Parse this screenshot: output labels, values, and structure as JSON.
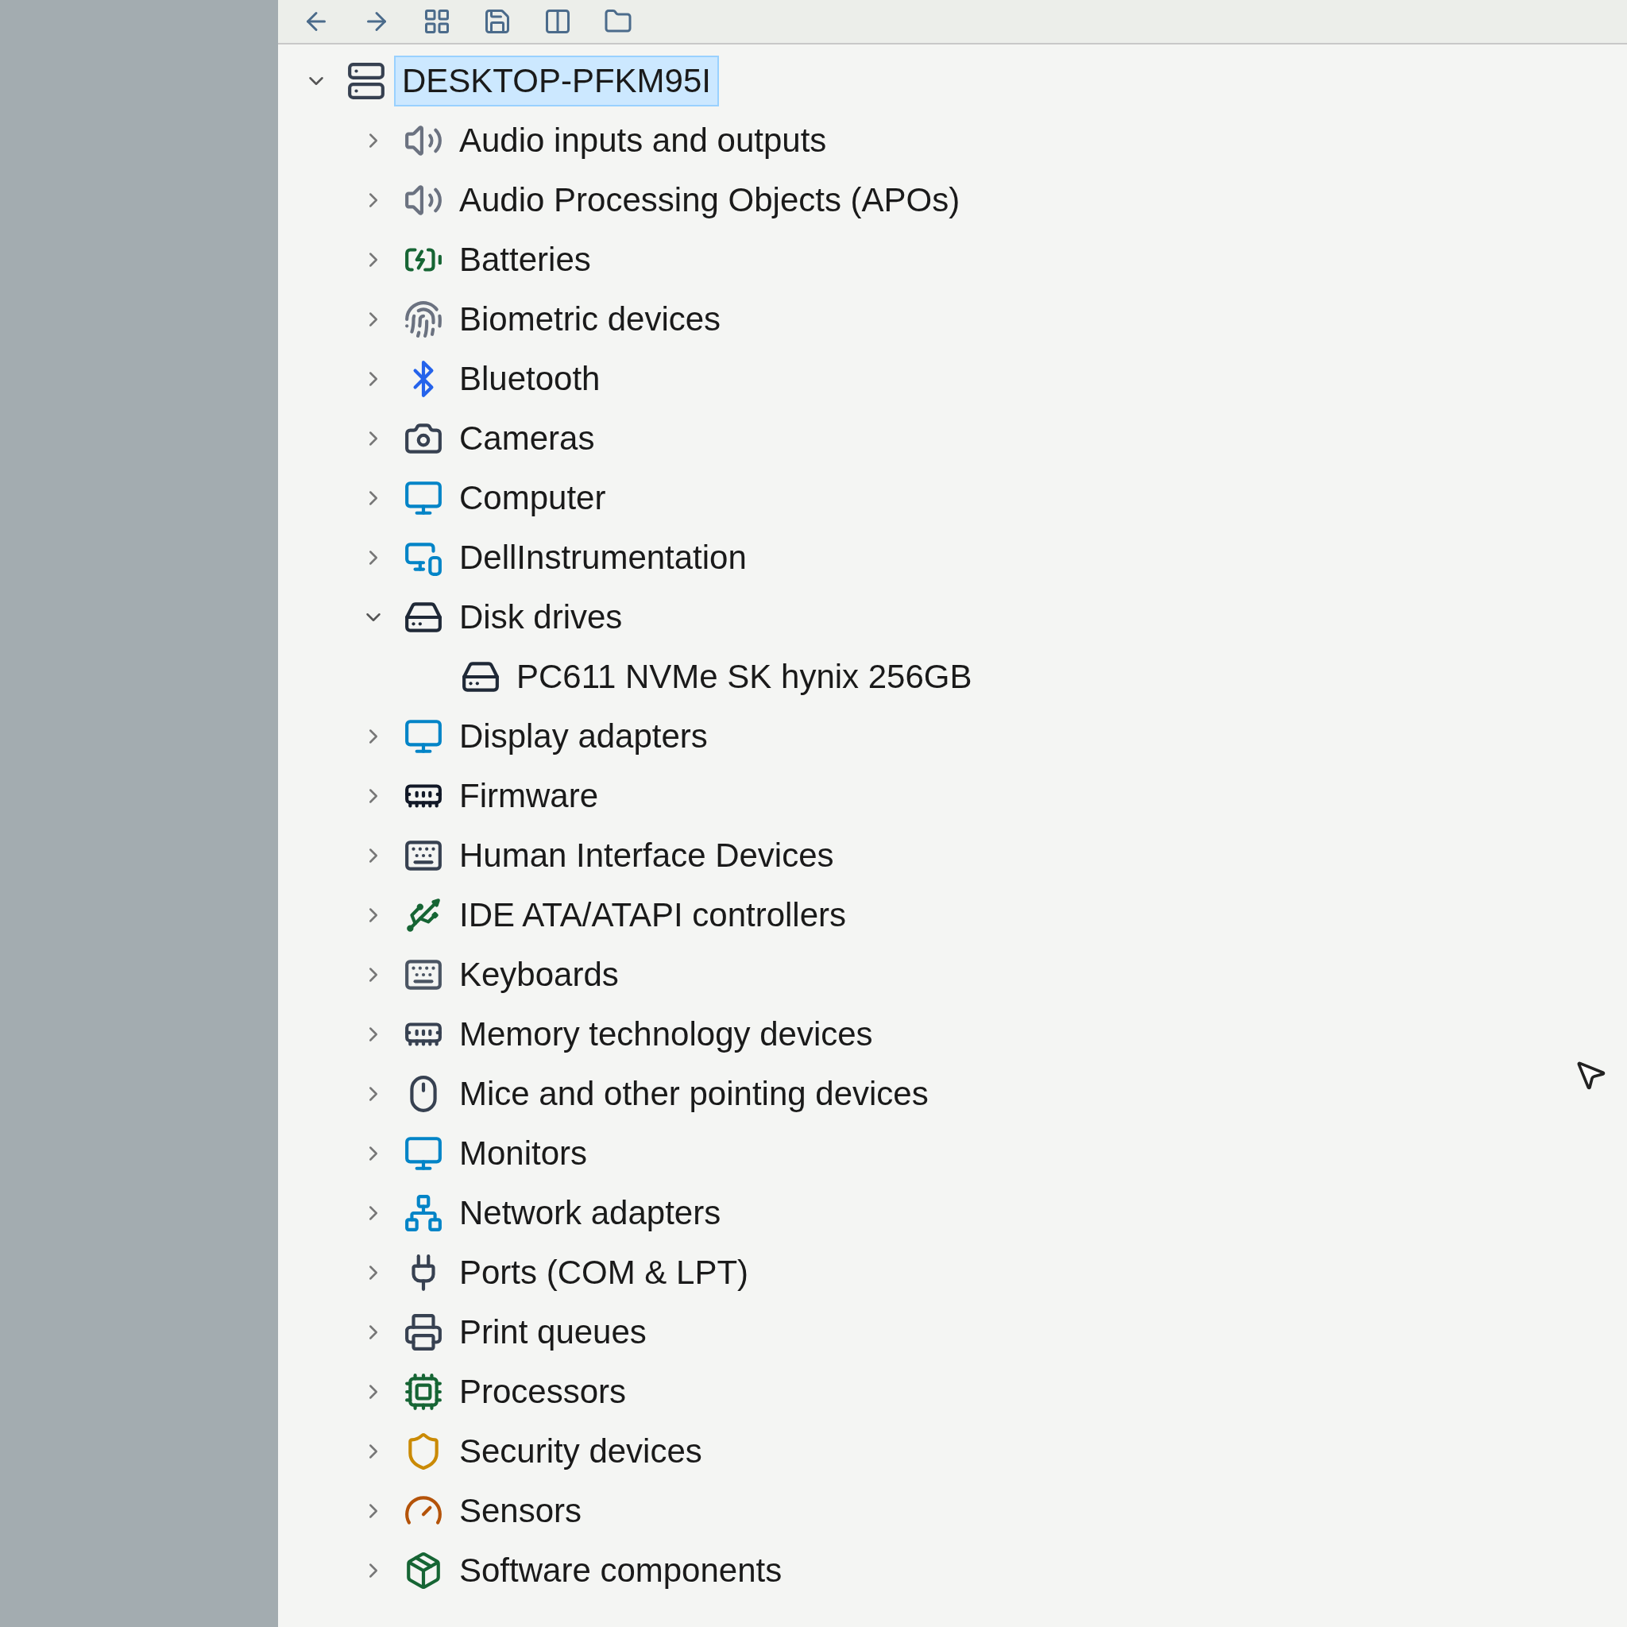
{
  "tree": {
    "root": {
      "label": "DESKTOP-PFKM95I",
      "expanded": true,
      "selected": true,
      "children": [
        {
          "label": "Audio inputs and outputs",
          "expanded": false,
          "selected": false
        },
        {
          "label": "Audio Processing Objects (APOs)",
          "expanded": false,
          "selected": false
        },
        {
          "label": "Batteries",
          "expanded": false,
          "selected": false
        },
        {
          "label": "Biometric devices",
          "expanded": false,
          "selected": false
        },
        {
          "label": "Bluetooth",
          "expanded": false,
          "selected": false
        },
        {
          "label": "Cameras",
          "expanded": false,
          "selected": false
        },
        {
          "label": "Computer",
          "expanded": false,
          "selected": false
        },
        {
          "label": "DellInstrumentation",
          "expanded": false,
          "selected": false
        },
        {
          "label": "Disk drives",
          "expanded": true,
          "selected": false,
          "children": [
            {
              "label": "PC611 NVMe SK hynix 256GB",
              "selected": false
            }
          ]
        },
        {
          "label": "Display adapters",
          "expanded": false,
          "selected": false
        },
        {
          "label": "Firmware",
          "expanded": false,
          "selected": false
        },
        {
          "label": "Human Interface Devices",
          "expanded": false,
          "selected": false
        },
        {
          "label": "IDE ATA/ATAPI controllers",
          "expanded": false,
          "selected": false
        },
        {
          "label": "Keyboards",
          "expanded": false,
          "selected": false
        },
        {
          "label": "Memory technology devices",
          "expanded": false,
          "selected": false
        },
        {
          "label": "Mice and other pointing devices",
          "expanded": false,
          "selected": false
        },
        {
          "label": "Monitors",
          "expanded": false,
          "selected": false
        },
        {
          "label": "Network adapters",
          "expanded": false,
          "selected": false
        },
        {
          "label": "Ports (COM & LPT)",
          "expanded": false,
          "selected": false
        },
        {
          "label": "Print queues",
          "expanded": false,
          "selected": false
        },
        {
          "label": "Processors",
          "expanded": false,
          "selected": false
        },
        {
          "label": "Security devices",
          "expanded": false,
          "selected": false
        },
        {
          "label": "Sensors",
          "expanded": false,
          "selected": false
        },
        {
          "label": "Software components",
          "expanded": false,
          "selected": false
        }
      ]
    }
  }
}
